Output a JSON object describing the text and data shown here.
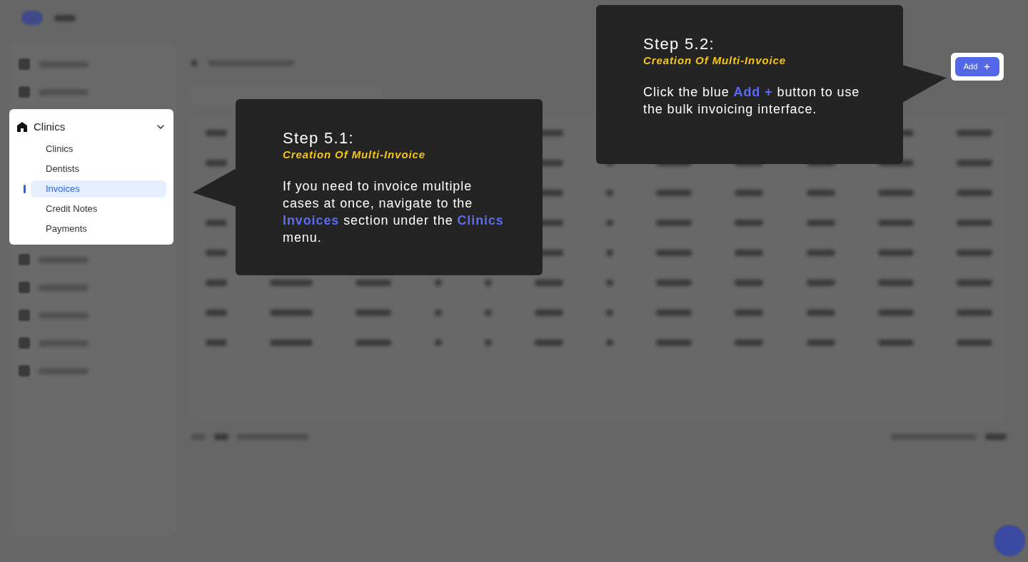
{
  "sidebar_menu": {
    "group": {
      "label": "Clinics",
      "expanded": true
    },
    "items": [
      {
        "label": "Clinics",
        "selected": false
      },
      {
        "label": "Dentists",
        "selected": false
      },
      {
        "label": "Invoices",
        "selected": true
      },
      {
        "label": "Credit Notes",
        "selected": false
      },
      {
        "label": "Payments",
        "selected": false
      }
    ]
  },
  "steps": [
    {
      "title": "Step 5.1:",
      "subtitle": "Creation Of Multi-Invoice",
      "body": "If you need to invoice multiple cases at once, navigate to the **Invoices** section under the **Clinics** menu."
    },
    {
      "title": "Step 5.2:",
      "subtitle": "Creation Of Multi-Invoice",
      "body": "Click the blue **Add +** button to use the bulk invoicing interface."
    }
  ],
  "add_button": {
    "label": "Add"
  }
}
